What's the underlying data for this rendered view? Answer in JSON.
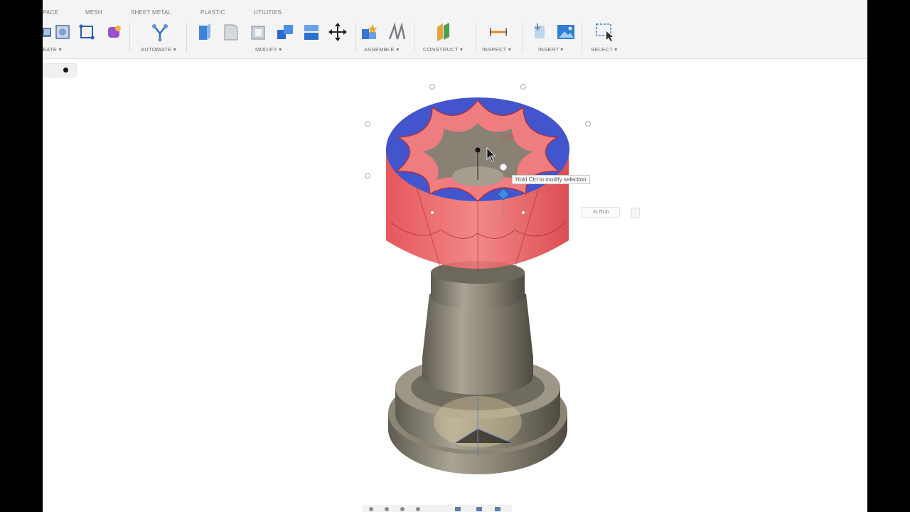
{
  "toolbar": {
    "tabs": [
      "PACE",
      "MESH",
      "SHEET METAL",
      "PLASTIC",
      "UTILITIES"
    ],
    "groups": [
      "EATE ▾",
      "AUTOMATE ▾",
      "MODIFY ▾",
      "ASSEMBLE ▾",
      "CONSTRUCT ▾",
      "INSPECT ▾",
      "INSERT ▾",
      "SELECT ▾"
    ]
  },
  "viewport": {
    "tooltip": "Hold Ctrl to modify selection",
    "dimension_value": "-0.70 in",
    "sketch_label": "0.70"
  },
  "colors": {
    "selection_red": "#e8464a",
    "face_blue": "#4255cc",
    "model_metal": "#8a8575"
  },
  "icons": [
    "box-icon",
    "sketch-icon",
    "form-icon",
    "automate-icon",
    "press-pull-icon",
    "fillet-icon",
    "shell-icon",
    "combine-icon",
    "split-face-icon",
    "move-icon",
    "new-component-icon",
    "joint-icon",
    "construct-plane-icon",
    "measure-icon",
    "insert-canvas-icon",
    "insert-image-icon",
    "select-icon"
  ]
}
